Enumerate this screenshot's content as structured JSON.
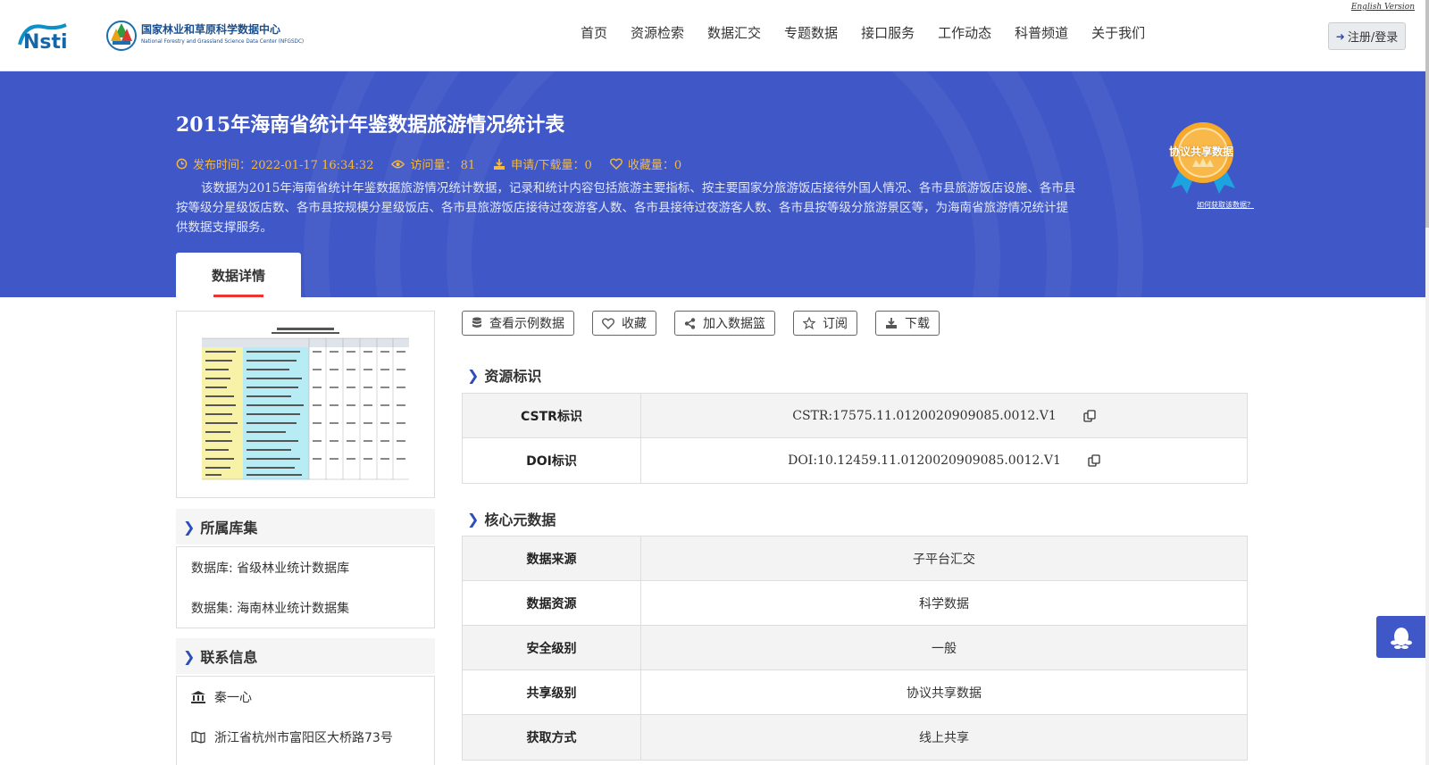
{
  "header": {
    "english_link": "English Version",
    "logo_left": "Nsti",
    "org_name_cn": "国家林业和草原科学数据中心",
    "org_name_en": "National Forestry and Grassland Science Data Center (NFGSDC)",
    "nav": [
      "首页",
      "资源检索",
      "数据汇交",
      "专题数据",
      "接口服务",
      "工作动态",
      "科普频道",
      "关于我们"
    ],
    "login_label": "注册/登录"
  },
  "banner": {
    "title": "2015年海南省统计年鉴数据旅游情况统计表",
    "publish_time": "发布时间：2022-01-17 16:34:32",
    "visits": "访问量： 81",
    "downloads": "申请/下载量：0",
    "favorites": "收藏量：0",
    "description": "该数据为2015年海南省统计年鉴数据旅游情况统计数据，记录和统计内容包括旅游主要指标、按主要国家分旅游饭店接待外国人情况、各市县旅游饭店设施、各市县按等级分星级饭店数、各市县按规模分星级饭店、各市县旅游饭店接待过夜游客人数、各市县接待过夜游客人数、各市县按等级分旅游景区等，为海南省旅游情况统计提供数据支撑服务。",
    "tab_label": "数据详情",
    "badge_text": "协议共享数据",
    "badge_help": "如何获取该数据？"
  },
  "sidebar": {
    "library_heading": "所属库集",
    "database": "数据库: 省级林业统计数据库",
    "dataset": "数据集: 海南林业统计数据集",
    "contact_heading": "联系信息",
    "contact_name": "秦一心",
    "contact_address": "浙江省杭州市富阳区大桥路73号"
  },
  "actions": [
    "查看示例数据",
    "收藏",
    "加入数据篮",
    "订阅",
    "下载"
  ],
  "resource_id": {
    "heading": "资源标识",
    "rows": [
      {
        "key": "CSTR标识",
        "value": "CSTR:17575.11.0120020909085.0012.V1"
      },
      {
        "key": "DOI标识",
        "value": "DOI:10.12459.11.0120020909085.0012.V1"
      }
    ]
  },
  "core_meta": {
    "heading": "核心元数据",
    "rows": [
      {
        "key": "数据来源",
        "value": "子平台汇交"
      },
      {
        "key": "数据资源",
        "value": "科学数据"
      },
      {
        "key": "安全级别",
        "value": "一般"
      },
      {
        "key": "共享级别",
        "value": "协议共享数据"
      },
      {
        "key": "获取方式",
        "value": "线上共享"
      }
    ]
  },
  "colors": {
    "banner": "#3f57c7",
    "accent": "#f5b942",
    "tab_underline": "#e33333"
  }
}
